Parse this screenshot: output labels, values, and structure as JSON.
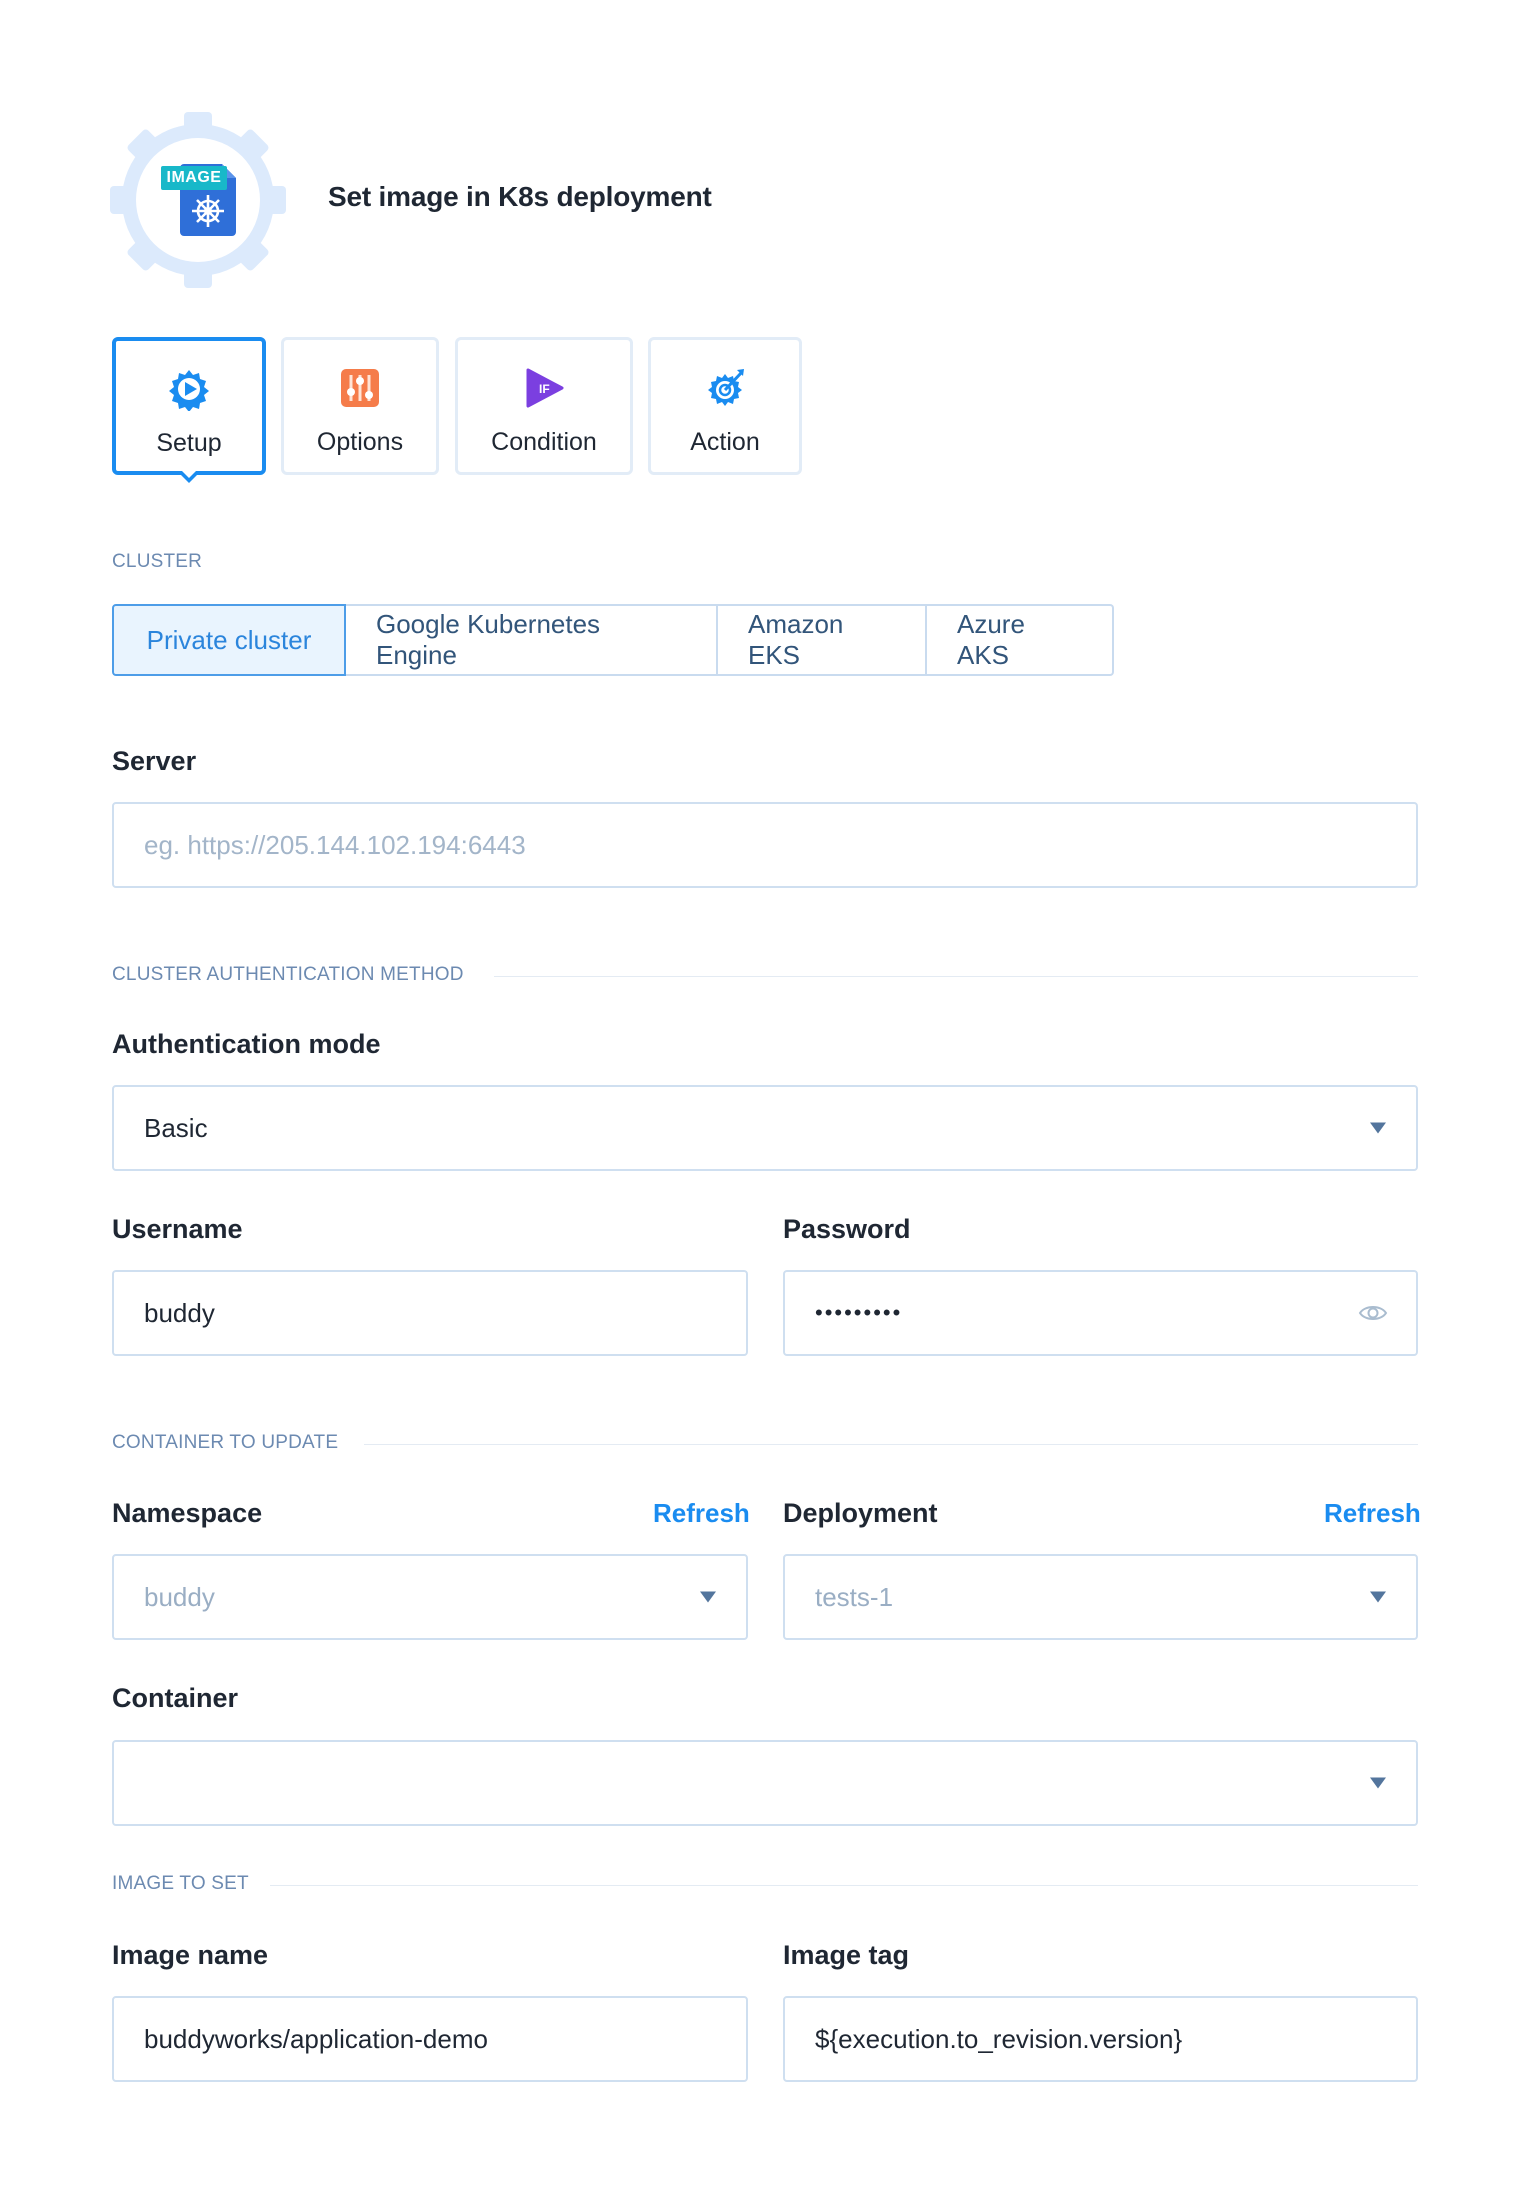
{
  "header": {
    "icon_badge": "IMAGE",
    "icon": "kubernetes-image-icon",
    "title": "Set image in K8s deployment"
  },
  "tabs": [
    {
      "label": "Setup",
      "icon": "play-gear-icon",
      "active": true
    },
    {
      "label": "Options",
      "icon": "sliders-icon",
      "active": false
    },
    {
      "label": "Condition",
      "icon": "if-play-icon",
      "active": false
    },
    {
      "label": "Action",
      "icon": "target-gear-icon",
      "active": false
    }
  ],
  "cluster": {
    "section_label": "CLUSTER",
    "options": [
      "Private cluster",
      "Google Kubernetes Engine",
      "Amazon EKS",
      "Azure AKS"
    ],
    "selected": "Private cluster"
  },
  "server": {
    "label": "Server",
    "placeholder": "eg. https://205.144.102.194:6443",
    "value": ""
  },
  "auth": {
    "section_label": "CLUSTER AUTHENTICATION METHOD",
    "mode_label": "Authentication mode",
    "mode_value": "Basic",
    "username_label": "Username",
    "username_value": "buddy",
    "password_label": "Password",
    "password_value": "•••••••••"
  },
  "container_update": {
    "section_label": "CONTAINER TO UPDATE",
    "namespace_label": "Namespace",
    "namespace_refresh": "Refresh",
    "namespace_value": "buddy",
    "deployment_label": "Deployment",
    "deployment_refresh": "Refresh",
    "deployment_value": "tests-1",
    "container_label": "Container",
    "container_value": ""
  },
  "image_to_set": {
    "section_label": "IMAGE TO SET",
    "name_label": "Image name",
    "name_value": "buddyworks/application-demo",
    "tag_label": "Image tag",
    "tag_value": "${execution.to_revision.version}"
  },
  "colors": {
    "accent": "#1a8cf0",
    "section_label": "#6c8ab1",
    "border": "#cfdff0",
    "gear_bg": "#dbeafc",
    "icon_blue": "#2f6fd8",
    "badge_teal": "#18b8c9",
    "options_orange": "#f57c4a",
    "condition_purple": "#7b3fe0"
  }
}
